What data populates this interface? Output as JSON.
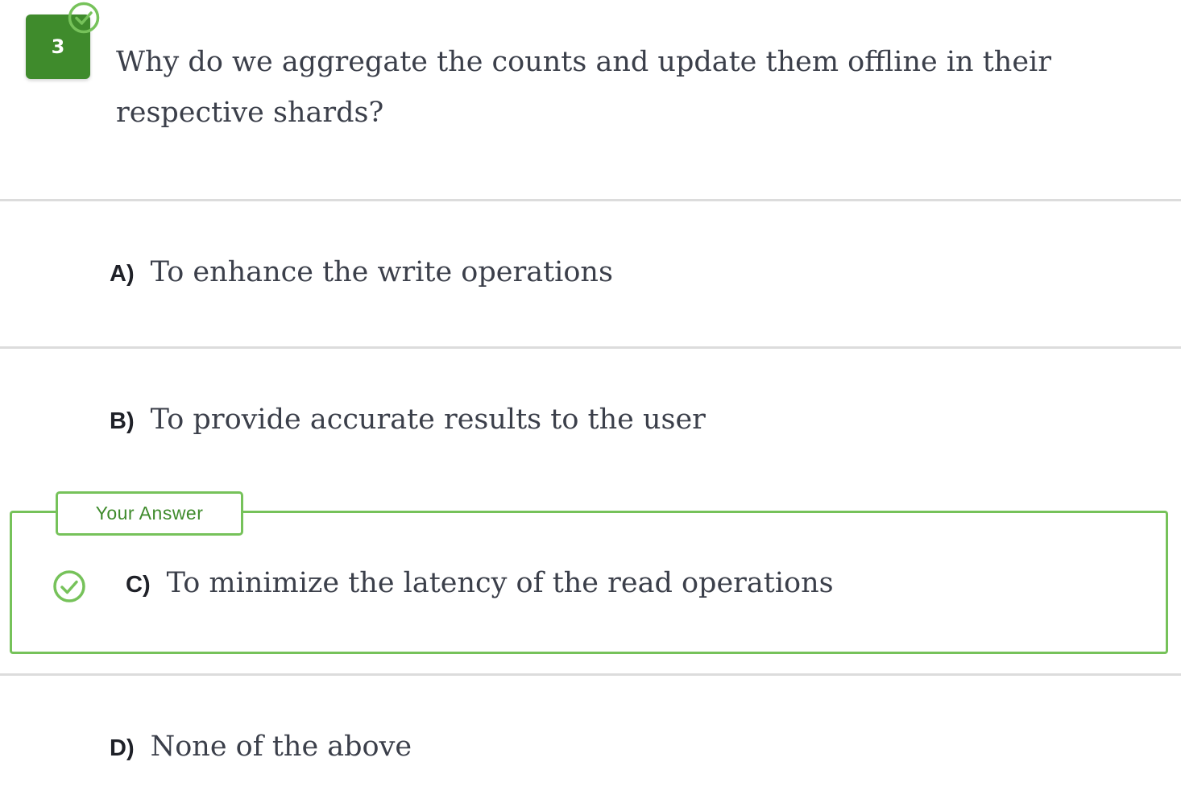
{
  "question": {
    "number": "3",
    "text": "Why do we aggregate the counts and update them offline in their respective shards?",
    "status_icon": "check-circle-icon"
  },
  "options": [
    {
      "letter": "A)",
      "text": "To enhance the write operations"
    },
    {
      "letter": "B)",
      "text": "To provide accurate results to the user"
    },
    {
      "letter": "C)",
      "text": "To minimize the latency of the read operations"
    },
    {
      "letter": "D)",
      "text": "None of the above"
    }
  ],
  "selected": {
    "tag_label": "Your Answer",
    "option_index": 2,
    "icon": "check-circle-icon"
  },
  "colors": {
    "badge_green": "#3f8b2c",
    "accent_green": "#76c25a",
    "divider": "#dcdcdc",
    "text": "#3b3f4a"
  }
}
